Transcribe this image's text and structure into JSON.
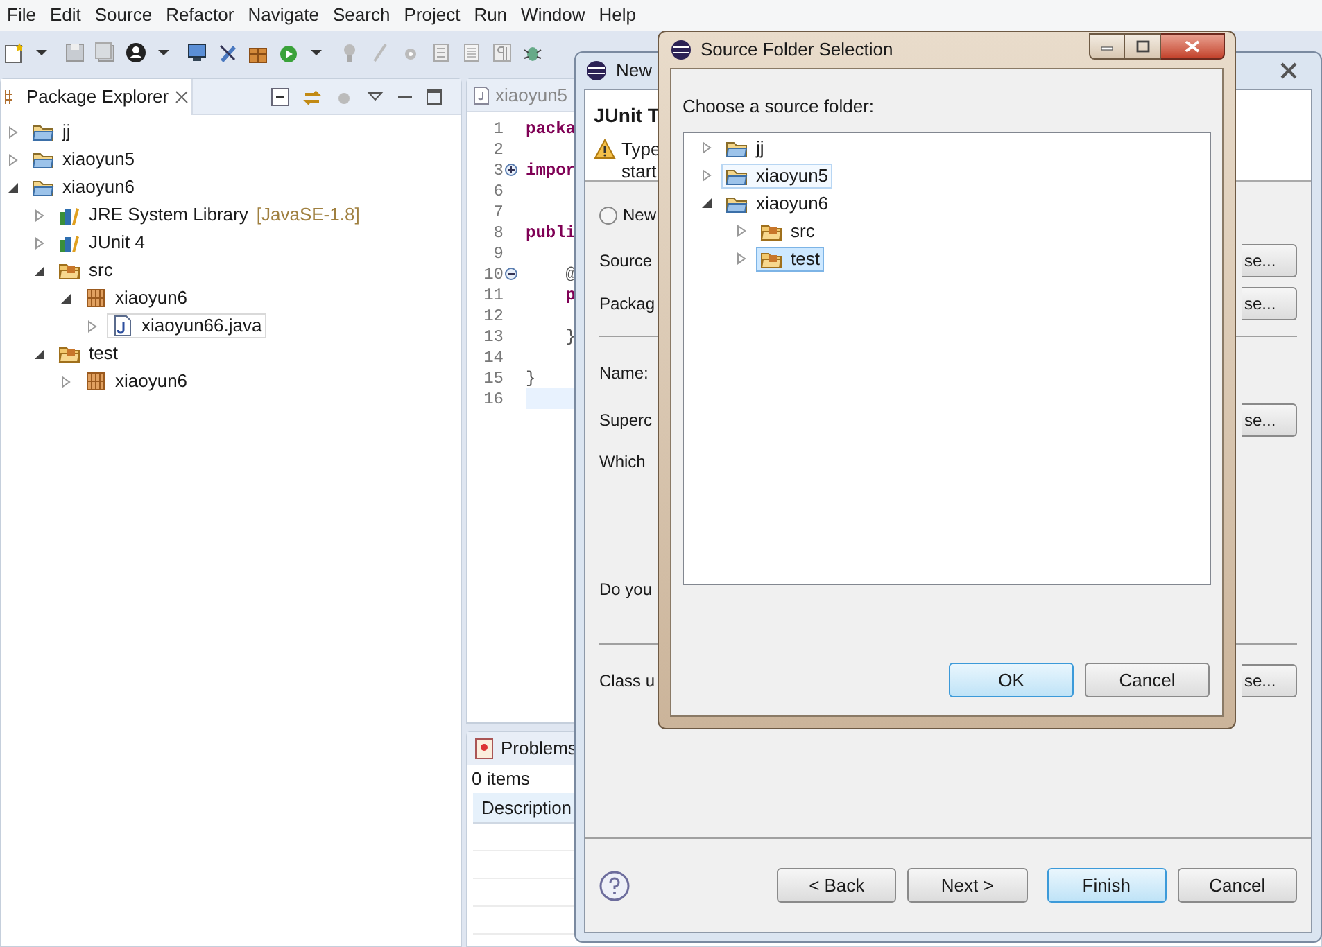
{
  "menu_bar": [
    "File",
    "Edit",
    "Source",
    "Refactor",
    "Navigate",
    "Search",
    "Project",
    "Run",
    "Window",
    "Help"
  ],
  "package_explorer": {
    "title": "Package Explorer",
    "tree": [
      {
        "label": "jj",
        "kind": "project",
        "expanded": false,
        "selected": false
      },
      {
        "label": "xiaoyun5",
        "kind": "project",
        "expanded": false,
        "selected": false
      },
      {
        "label": "xiaoyun6",
        "kind": "project",
        "expanded": true,
        "selected": false,
        "children": [
          {
            "label": "JRE System Library",
            "detail": "[JavaSE-1.8]",
            "kind": "library",
            "expanded": false,
            "selected": false
          },
          {
            "label": "JUnit 4",
            "kind": "library",
            "expanded": false,
            "selected": false
          },
          {
            "label": "src",
            "kind": "source_folder",
            "expanded": true,
            "selected": false,
            "children": [
              {
                "label": "xiaoyun6",
                "kind": "package",
                "expanded": true,
                "selected": false,
                "children": [
                  {
                    "label": "xiaoyun66.java",
                    "kind": "file",
                    "expanded": false,
                    "selected": true
                  }
                ]
              }
            ]
          },
          {
            "label": "test",
            "kind": "source_folder",
            "expanded": true,
            "selected": false,
            "children": [
              {
                "label": "xiaoyun6",
                "kind": "package",
                "expanded": false,
                "selected": false
              }
            ]
          }
        ]
      }
    ]
  },
  "editor": {
    "tab": "xiaoyun5",
    "lines": [
      {
        "number": "1",
        "code": "packa",
        "keyword": true,
        "current": false
      },
      {
        "number": "2",
        "current": false
      },
      {
        "number": "3",
        "code": "impor",
        "keyword": true,
        "folded": true,
        "current": false
      },
      {
        "number": "6",
        "current": false
      },
      {
        "number": "7",
        "current": false
      },
      {
        "number": "8",
        "code": "publi",
        "keyword": true,
        "current": false
      },
      {
        "number": "9",
        "current": false
      },
      {
        "number": "10",
        "code": "    @",
        "keyword": false,
        "folded": false,
        "current": false
      },
      {
        "number": "11",
        "code": "    p",
        "keyword": true,
        "current": false
      },
      {
        "number": "12",
        "current": false
      },
      {
        "number": "13",
        "code": "    }",
        "keyword": false,
        "current": false
      },
      {
        "number": "14",
        "current": false
      },
      {
        "number": "15",
        "code": "}",
        "keyword": false,
        "current": false
      },
      {
        "number": "16",
        "current": true
      }
    ]
  },
  "problems": {
    "title": "Problems",
    "count": "0 items",
    "columns": [
      "Description"
    ]
  },
  "junit_dialog": {
    "title": "New",
    "heading": "JUnit T",
    "message": [
      "Type",
      "start"
    ],
    "rows": [
      {
        "kind": "radio",
        "label": "New",
        "checked": false
      },
      {
        "kind": "field",
        "label": "Source",
        "button": "se..."
      },
      {
        "kind": "field",
        "label": "Packag",
        "button": "se..."
      },
      {
        "kind": "separator"
      },
      {
        "kind": "label",
        "label": "Name:"
      },
      {
        "kind": "field",
        "label": "Superc",
        "button": "se..."
      },
      {
        "kind": "label",
        "label": "Which"
      },
      {
        "kind": "label",
        "label": "Do you"
      },
      {
        "kind": "separator"
      },
      {
        "kind": "field",
        "label": "Class u",
        "button": "se..."
      }
    ],
    "buttons": [
      {
        "label": "< Back",
        "default": false
      },
      {
        "label": "Next >",
        "default": false
      },
      {
        "label": "Finish",
        "default": true
      },
      {
        "label": "Cancel",
        "default": false
      }
    ]
  },
  "source_folder_dialog": {
    "title": "Source Folder Selection",
    "prompt": "Choose a source folder:",
    "tree": [
      {
        "label": "jj",
        "kind": "project",
        "expanded": false,
        "selected": false,
        "hovered": false
      },
      {
        "label": "xiaoyun5",
        "kind": "project",
        "expanded": false,
        "selected": false,
        "hovered": true
      },
      {
        "label": "xiaoyun6",
        "kind": "project",
        "expanded": true,
        "selected": false,
        "hovered": false,
        "children": [
          {
            "label": "src",
            "kind": "source_folder",
            "expanded": false,
            "selected": false,
            "hovered": false
          },
          {
            "label": "test",
            "kind": "source_folder",
            "expanded": false,
            "selected": true,
            "hovered": false
          }
        ]
      }
    ],
    "buttons": [
      {
        "label": "OK",
        "default": true
      },
      {
        "label": "Cancel",
        "default": false
      }
    ]
  }
}
